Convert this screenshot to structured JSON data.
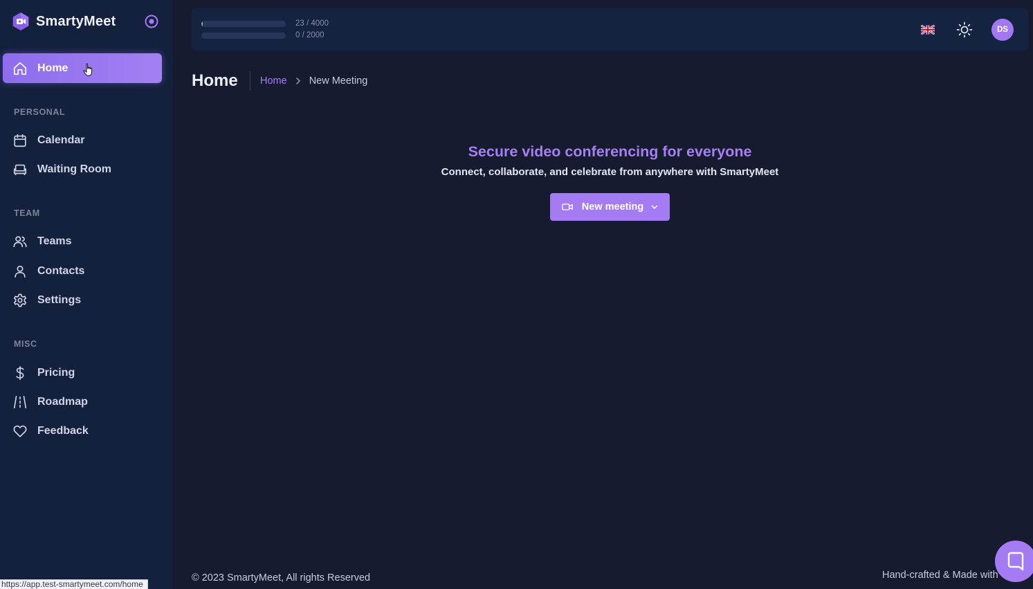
{
  "brand": {
    "name": "SmartyMeet",
    "accent": "#a47bf2"
  },
  "sidebar": {
    "active_item": {
      "label": "Home",
      "icon": "home-icon"
    },
    "sections": [
      {
        "title": "PERSONAL",
        "items": [
          {
            "label": "Calendar",
            "icon": "calendar-icon"
          },
          {
            "label": "Waiting Room",
            "icon": "sofa-icon"
          }
        ]
      },
      {
        "title": "TEAM",
        "items": [
          {
            "label": "Teams",
            "icon": "users-icon"
          },
          {
            "label": "Contacts",
            "icon": "user-icon"
          },
          {
            "label": "Settings",
            "icon": "gear-icon"
          }
        ]
      },
      {
        "title": "MISC",
        "items": [
          {
            "label": "Pricing",
            "icon": "dollar-icon"
          },
          {
            "label": "Roadmap",
            "icon": "road-icon"
          },
          {
            "label": "Feedback",
            "icon": "heart-icon"
          }
        ]
      }
    ]
  },
  "topbar": {
    "usage": [
      {
        "used": 23,
        "limit": 4000,
        "text": "23 / 4000"
      },
      {
        "used": 0,
        "limit": 2000,
        "text": "0 / 2000"
      }
    ],
    "language_flag": "uk-flag-icon",
    "theme_toggle": "sun-icon",
    "avatar_initials": "DS"
  },
  "page": {
    "title": "Home",
    "breadcrumb": [
      "Home",
      "New Meeting"
    ]
  },
  "hero": {
    "title": "Secure video conferencing for everyone",
    "subtitle": "Connect, collaborate, and celebrate from anywhere with SmartyMeet",
    "button_label": "New meeting"
  },
  "footer": {
    "copyright": "© 2023 SmartyMeet, All rights Reserved",
    "made_with": "Hand-crafted & Made with"
  },
  "status_bar": {
    "url": "https://app.test-smartymeet.com/home"
  }
}
